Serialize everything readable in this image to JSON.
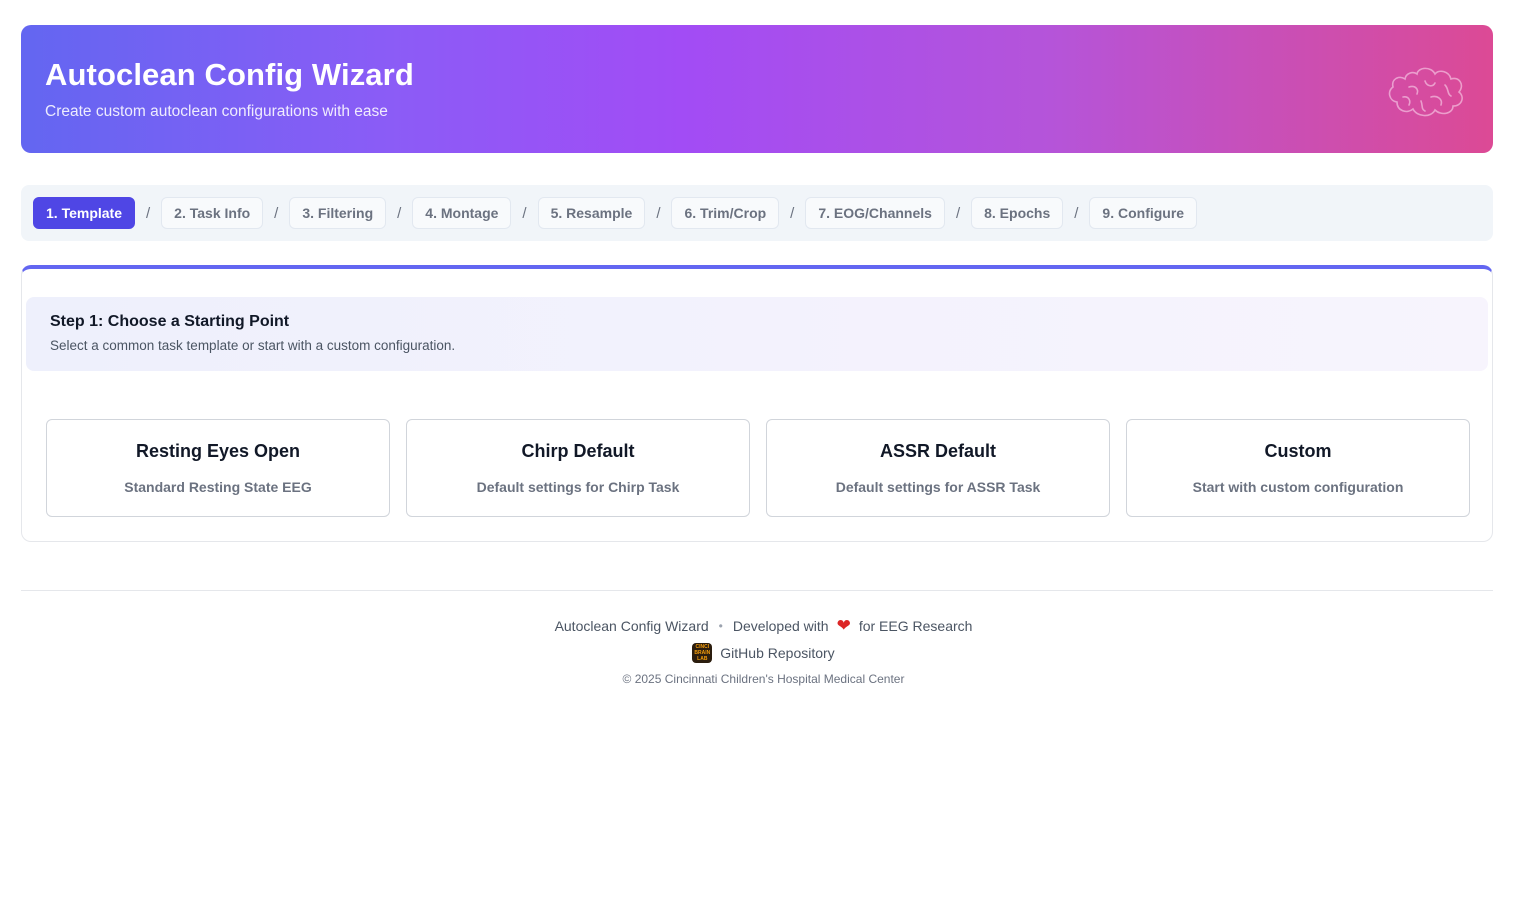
{
  "header": {
    "title": "Autoclean Config Wizard",
    "subtitle": "Create custom autoclean configurations with ease",
    "icon": "brain-icon"
  },
  "steps": [
    {
      "label": "1. Template",
      "active": true
    },
    {
      "label": "2. Task Info"
    },
    {
      "label": "3. Filtering"
    },
    {
      "label": "4. Montage"
    },
    {
      "label": "5. Resample"
    },
    {
      "label": "6. Trim/Crop"
    },
    {
      "label": "7. EOG/Channels"
    },
    {
      "label": "8. Epochs"
    },
    {
      "label": "9. Configure"
    }
  ],
  "step_separator": "/",
  "step_panel": {
    "title": "Step 1: Choose a Starting Point",
    "description": "Select a common task template or start with a custom configuration."
  },
  "templates": [
    {
      "title": "Resting Eyes Open",
      "description": "Standard Resting State EEG"
    },
    {
      "title": "Chirp Default",
      "description": "Default settings for Chirp Task"
    },
    {
      "title": "ASSR Default",
      "description": "Default settings for ASSR Task"
    },
    {
      "title": "Custom",
      "description": "Start with custom configuration"
    }
  ],
  "footer": {
    "app_name": "Autoclean Config Wizard",
    "separator": "•",
    "developed_prefix": "Developed with",
    "heart": "❤",
    "developed_suffix": "for EEG Research",
    "lab_logo_text": "CINCI BRAIN LAB",
    "github_label": "GitHub Repository",
    "copyright": "© 2025 Cincinnati Children's Hospital Medical Center"
  },
  "colors": {
    "accent": "#4f46e5",
    "gradient_start": "#6366f1",
    "gradient_end": "#dc4a95"
  }
}
